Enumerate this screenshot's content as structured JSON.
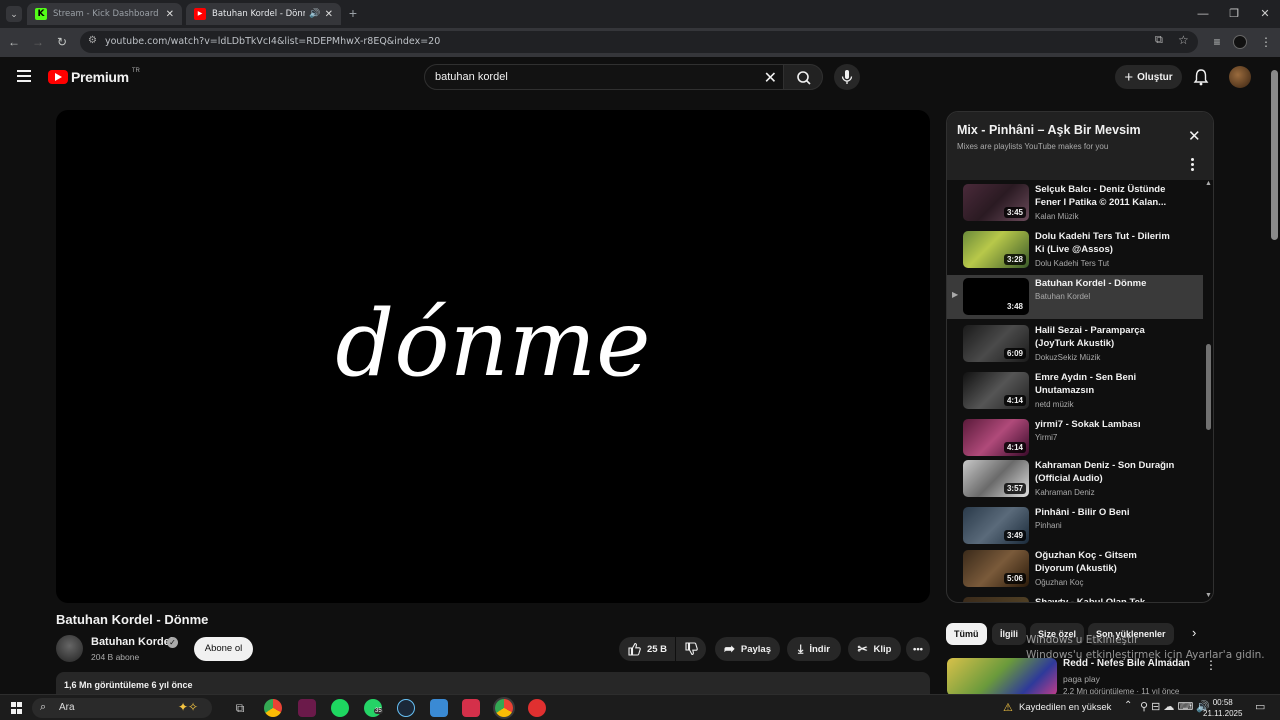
{
  "browser": {
    "tabs": [
      {
        "title": "Stream - Kick Dashboard",
        "favicon_color": "#53fc18",
        "favicon_letter": "K"
      },
      {
        "title": "Batuhan Kordel - Dönme",
        "favicon_color": "#ff0000",
        "favicon_letter": "▶"
      }
    ],
    "url": "youtube.com/watch?v=ldLDbTkVcI4&list=RDEPMhwX-r8EQ&index=20"
  },
  "header": {
    "logo_word": "Premium",
    "country_code": "TR",
    "search_value": "batuhan kordel",
    "create_label": "Oluştur"
  },
  "video": {
    "title": "Batuhan Kordel - Dönme",
    "overlay_text": "dónme",
    "channel": "Batuhan Kordel",
    "subscribers": "204 B abone",
    "subscribe_label": "Abone ol",
    "likes": "25 B",
    "share_label": "Paylaş",
    "download_label": "İndir",
    "clip_label": "Klip",
    "views_line": "1,6 Mn görüntüleme  6 yıl önce"
  },
  "playlist": {
    "title": "Mix - Pinhâni – Aşk Bir Mevsim",
    "subtitle": "Mixes are playlists YouTube makes for you",
    "items": [
      {
        "title": "Selçuk Balcı - Deniz Üstünde Fener I Patika © 2011 Kalan...",
        "channel": "Kalan Müzik",
        "duration": "3:45",
        "thumb": "linear-gradient(135deg,#4a2a3a,#2a1a22 50%,#6a4a5a)"
      },
      {
        "title": "Dolu Kadehi Ters Tut - Dilerim Ki (Live @Assos)",
        "channel": "Dolu Kadehi Ters Tut",
        "duration": "3:28",
        "thumb": "linear-gradient(135deg,#6a8a3a,#b8c84a 40%,#3a5a2a)"
      },
      {
        "title": "Batuhan Kordel - Dönme",
        "channel": "Batuhan Kordel",
        "duration": "3:48",
        "thumb": "#000"
      },
      {
        "title": "Halil Sezai - Paramparça (JoyTurk Akustik)",
        "channel": "DokuzSekiz Müzik",
        "duration": "6:09",
        "thumb": "linear-gradient(135deg,#1a1a1a,#4a4a4a 50%,#1a1a1a)"
      },
      {
        "title": "Emre Aydın - Sen Beni Unutamazsın",
        "channel": "netd müzik",
        "duration": "4:14",
        "thumb": "linear-gradient(135deg,#111,#555 50%,#222)"
      },
      {
        "title": "yirmi7 - Sokak Lambası",
        "channel": "Yirmi7",
        "duration": "4:14",
        "thumb": "linear-gradient(135deg,#5a1a3a,#b04a7a 50%,#3a0a2a)"
      },
      {
        "title": "Kahraman Deniz - Son Durağın (Official Audio)",
        "channel": "Kahraman Deniz",
        "duration": "3:57",
        "thumb": "linear-gradient(135deg,#c8c8c8,#6a6a6a 50%,#e0e0e0)"
      },
      {
        "title": "Pinhâni - Bilir O Beni",
        "channel": "Pinhani",
        "duration": "3:49",
        "thumb": "linear-gradient(135deg,#2a3a4a,#5a6a7a 50%,#1a2a3a)"
      },
      {
        "title": "Oğuzhan Koç - Gitsem Diyorum (Akustik)",
        "channel": "Oğuzhan Koç",
        "duration": "5:06",
        "thumb": "linear-gradient(135deg,#3a2a1a,#7a5a3a 50%,#2a1a0a)"
      },
      {
        "title": "Shawty - Kabul Olan Tek",
        "channel": "",
        "duration": "",
        "thumb": "linear-gradient(135deg,#3a2a1a,#5a4a2a)"
      }
    ]
  },
  "chips": [
    "Tümü",
    "İlgili",
    "Size özel",
    "Son yüklenenler"
  ],
  "recommendation": {
    "title": "Redd - Nefes Bile Almadan",
    "channel": "paga play",
    "meta": "2,2 Mn görüntüleme · 11 yıl önce"
  },
  "watermark": {
    "line1": "Windows'u Etkinleştir",
    "line2": "Windows'u etkinleştirmek için Ayarlar'a gidin."
  },
  "taskbar": {
    "search_label": "Ara",
    "whatsapp_badge": "35",
    "notice": "Kaydedilen en yüksek",
    "time": "00:58",
    "date": "21.11.2025"
  }
}
